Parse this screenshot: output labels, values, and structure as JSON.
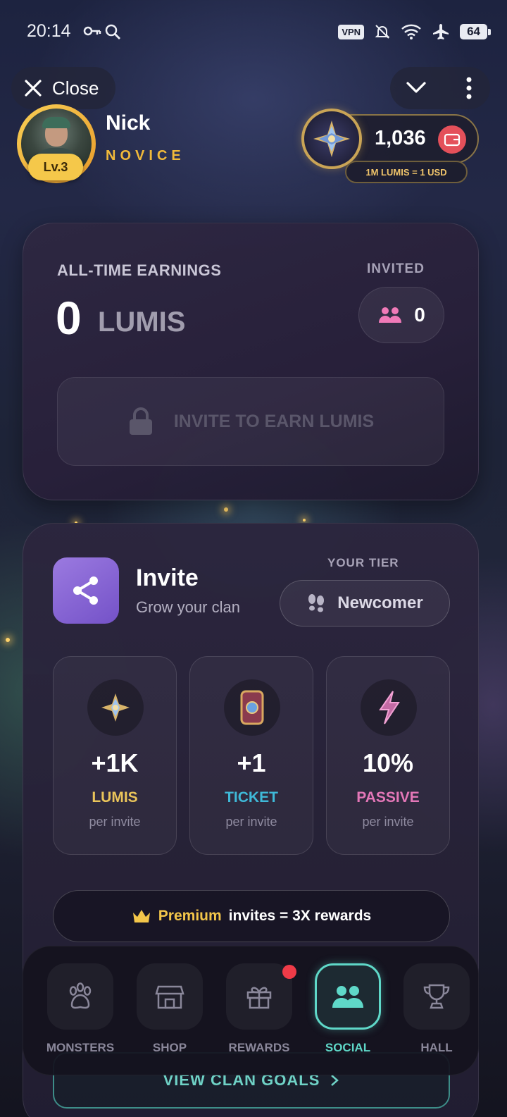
{
  "status_bar": {
    "time": "20:14",
    "vpn": "VPN",
    "battery": "64"
  },
  "top_bar": {
    "close_label": "Close"
  },
  "profile": {
    "name": "Nick",
    "rank": "NOVICE",
    "level": "Lv.3"
  },
  "balance": {
    "value": "1,036",
    "rate": "1M LUMIS = 1 USD"
  },
  "earnings": {
    "label": "ALL-TIME EARNINGS",
    "value": "0",
    "unit": "LUMIS",
    "invited_label": "INVITED",
    "invited_count": "0",
    "invite_button": "INVITE TO EARN LUMIS"
  },
  "invite": {
    "title": "Invite",
    "subtitle": "Grow your clan",
    "tier_label": "YOUR TIER",
    "tier_name": "Newcomer",
    "rewards": [
      {
        "value": "+1K",
        "name": "LUMIS",
        "per": "per invite",
        "color": "#e9c45a",
        "icon": "gem-icon"
      },
      {
        "value": "+1",
        "name": "TICKET",
        "per": "per invite",
        "color": "#3fb9d8",
        "icon": "ticket-icon"
      },
      {
        "value": "10%",
        "name": "PASSIVE",
        "per": "per invite",
        "color": "#e477b8",
        "icon": "lightning-icon"
      }
    ],
    "premium_highlight": "Premium",
    "premium_rest": "invites = 3X rewards",
    "clan_goals": "VIEW CLAN GOALS"
  },
  "nav": {
    "items": [
      {
        "label": "MONSTERS",
        "icon": "paw-icon"
      },
      {
        "label": "SHOP",
        "icon": "store-icon"
      },
      {
        "label": "REWARDS",
        "icon": "gift-icon",
        "notification": true
      },
      {
        "label": "SOCIAL",
        "icon": "people-icon",
        "active": true
      },
      {
        "label": "HALL",
        "icon": "trophy-icon"
      }
    ]
  },
  "colors": {
    "accent_teal": "#5fd8c8",
    "gold": "#f3c64a",
    "wallet_red": "#e4505a",
    "share_purple": "#8b68d8"
  }
}
